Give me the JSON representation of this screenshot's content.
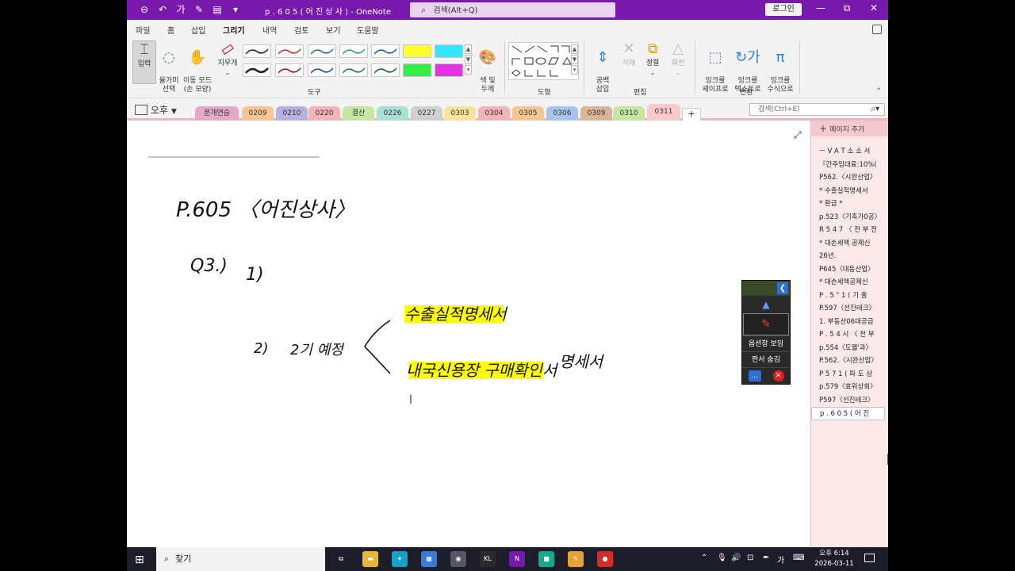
{
  "titlebar": {
    "title": "p . 6 0 5 ( 어 진 상 사 )  -  OneNote",
    "search_placeholder": "검색(Alt+Q)",
    "login_label": "로그인",
    "qat_icons": [
      "back-icon",
      "undo-icon",
      "text-format-icon",
      "pen-icon",
      "paste-icon",
      "customize-icon"
    ]
  },
  "menu": {
    "items": [
      "파일",
      "홈",
      "삽입",
      "그리기",
      "내역",
      "검토",
      "보기",
      "도움말"
    ],
    "active": "그리기"
  },
  "ribbon": {
    "input_label": "입력",
    "lasso_label": "올가미\n선택",
    "pan_label": "이동 모드\n(손 모양)",
    "eraser_label": "지우개",
    "color_thickness_label": "색 및\n두께",
    "tools_group": "도구",
    "shapes_group": "도형",
    "insert_space_label": "공백\n삽입",
    "delete_label": "삭제",
    "arrange_label": "정렬",
    "rotate_label": "회전",
    "edit_group": "편집",
    "ink_to_shape_label": "잉크를\n셰이프로",
    "ink_to_text_label": "잉크를\n텍스트로",
    "ink_to_math_label": "잉크를\n수식으로",
    "convert_group": "변환",
    "pen_colors": [
      "#222222",
      "#c0392b",
      "#2471a3",
      "#27ae60",
      "#1a5e9e",
      "#ffff33",
      "#33e5ff",
      "#222222",
      "#a01030",
      "#1f4e8c",
      "#1e7d3c",
      "#1a5f2c",
      "#33ee44",
      "#e633e6"
    ]
  },
  "sections": {
    "notebook_name": "오후",
    "tabs": [
      {
        "label": "분개연습",
        "color": "#e5a8c9"
      },
      {
        "label": "0209",
        "color": "#f5c594"
      },
      {
        "label": "0210",
        "color": "#b9b0e0"
      },
      {
        "label": "0220",
        "color": "#f4b3b8"
      },
      {
        "label": "결산",
        "color": "#c6e6a2"
      },
      {
        "label": "0226",
        "color": "#a8e0d6"
      },
      {
        "label": "0227",
        "color": "#d0d0d0"
      },
      {
        "label": "0303",
        "color": "#f7e399"
      },
      {
        "label": "0304",
        "color": "#f4b3b8"
      },
      {
        "label": "0305",
        "color": "#f5c594"
      },
      {
        "label": "0306",
        "color": "#a9c4ea"
      },
      {
        "label": "0309",
        "color": "#d9b59a"
      },
      {
        "label": "0310",
        "color": "#c6e6a2"
      },
      {
        "label": "0311",
        "color": "#f8c9cf"
      }
    ],
    "active": "0311",
    "page_search_placeholder": "검색(Ctrl+E)"
  },
  "canvas": {
    "ink_notes": [
      "P.605 〈어진상사〉",
      "Q3.)",
      "1)",
      "2)",
      "2기 예정",
      "수출실적명세서",
      "내국신용장 구매확인서",
      "명세서"
    ],
    "highlight_color": "#ffff00"
  },
  "pagelist": {
    "add_page_label": "페이지 추가",
    "pages": [
      "ㅡ V A T 소 소 서",
      "『간주임대료:10%(",
      "P562.〈시완산업〉",
      "* 수출실적명세서",
      "* 환급 *",
      "p.523〈기축가0공〉",
      "R 5 4 7 〈 전 부 전",
      "* 대손세액 공제신",
      "26년.",
      "P645〈대동산업〉",
      "* 대손세액공제신",
      "P . 5 \" 1 ( 기 출",
      "P.597〈선진테크〉",
      "1. 부동산06대공급",
      "P . 5 4 시 〈 전 부",
      "p.554〈도웰'과〉",
      "P.562.〈시완산업〉",
      "P 5 7 1 ( 파 도 상",
      "p.579〈효워상회〉",
      "P597〈선진테크〉",
      "p . 6 0 5 ( 어 진"
    ],
    "current_index": 20
  },
  "float_toolbar": {
    "show_options_label": "옵션창 보임",
    "hide_board_label": "판서 숨김"
  },
  "taskbar": {
    "search_label": "찾기",
    "time": "오후 6:14",
    "date": "2026-03-11",
    "ime": "가",
    "apps": [
      {
        "name": "taskview-icon",
        "label": "⧉",
        "color": "transparent"
      },
      {
        "name": "file-explorer-icon",
        "label": "▬",
        "color": "#e8b637"
      },
      {
        "name": "bird-app-icon",
        "label": "✦",
        "color": "#19a0c8"
      },
      {
        "name": "calculator-icon",
        "label": "▦",
        "color": "#3a7bd5"
      },
      {
        "name": "paint-icon",
        "label": "◉",
        "color": "#556"
      },
      {
        "name": "kl-app-icon",
        "label": "KL",
        "color": "#2b2b2b"
      },
      {
        "name": "onenote-icon",
        "label": "N",
        "color": "#7719aa"
      },
      {
        "name": "camera-app-icon",
        "label": "■",
        "color": "#18a88a"
      },
      {
        "name": "pencil-app-icon",
        "label": "✎",
        "color": "#e8a23a"
      },
      {
        "name": "record-app-icon",
        "label": "●",
        "color": "#d62b2b"
      }
    ]
  }
}
